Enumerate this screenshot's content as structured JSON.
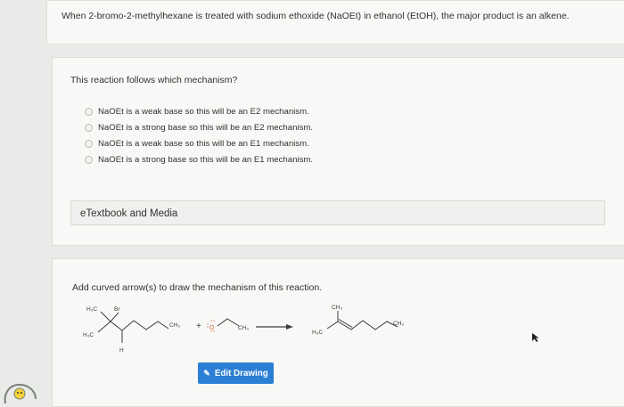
{
  "question": {
    "stem": "When 2-bromo-2-methylhexane is treated with sodium ethoxide (NaOEt) in ethanol (EtOH), the major product is an alkene."
  },
  "mechanism_question": {
    "prompt": "This reaction follows which mechanism?",
    "options": [
      "NaOEt is a weak base so this will be an E2 mechanism.",
      "NaOEt is a strong base so this will be an E2 mechanism.",
      "NaOEt is a weak base so this will be an E1 mechanism.",
      "NaOEt is a strong base so this will be an E1 mechanism."
    ],
    "etextbook_label": "eTextbook and Media"
  },
  "drawing_question": {
    "prompt": "Add curved arrow(s) to draw the mechanism of this reaction.",
    "edit_button_label": "Edit Drawing",
    "reactant_labels": {
      "h3c_top": "H₃C",
      "br": "Br",
      "h3c_left": "H₃C",
      "h": "H",
      "ch3_right": "CH₃"
    },
    "plus": "+",
    "ethoxide_labels": {
      "o": "O",
      "ch3": "CH₃"
    },
    "product_labels": {
      "ch3_top": "CH₃",
      "h3c_left": "H₃C",
      "ch3_right": "CH₃"
    }
  },
  "colors": {
    "accent": "#2b7fd4",
    "card": "#f8f9f6",
    "background": "#e9ebe8"
  }
}
